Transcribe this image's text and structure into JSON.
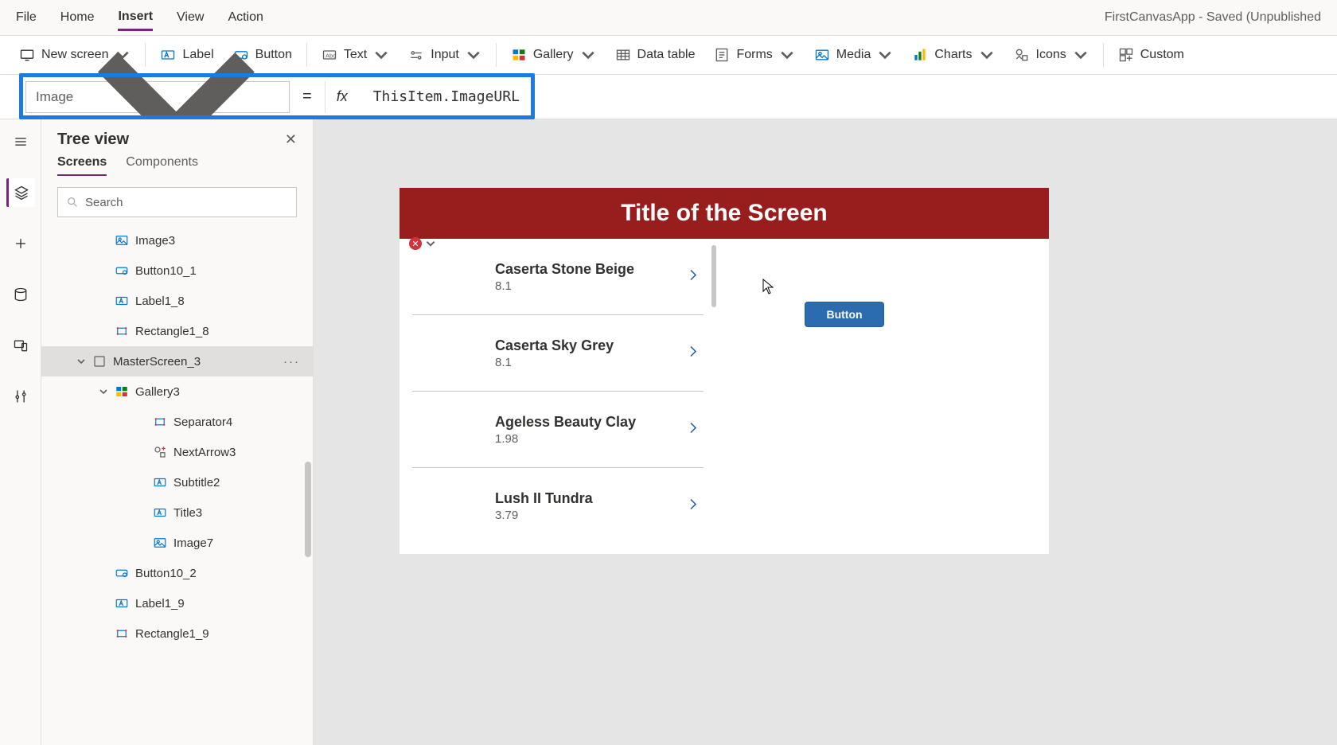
{
  "menubar": {
    "items": [
      "File",
      "Home",
      "Insert",
      "View",
      "Action"
    ],
    "active_index": 2,
    "app_title": "FirstCanvasApp - Saved (Unpublished"
  },
  "ribbon": {
    "new_screen": "New screen",
    "label": "Label",
    "button": "Button",
    "text": "Text",
    "input": "Input",
    "gallery": "Gallery",
    "data_table": "Data table",
    "forms": "Forms",
    "media": "Media",
    "charts": "Charts",
    "icons": "Icons",
    "custom": "Custom"
  },
  "formula": {
    "property": "Image",
    "equals": "=",
    "fx": "fx",
    "expression": "ThisItem.ImageURL"
  },
  "left_rail": {
    "items": [
      "menu",
      "tree",
      "add",
      "data",
      "media",
      "advanced"
    ]
  },
  "tree_panel": {
    "title": "Tree view",
    "tabs": [
      "Screens",
      "Components"
    ],
    "active_tab": 0,
    "search_placeholder": "Search",
    "items": [
      {
        "label": "Image3",
        "icon": "image",
        "indent": 2,
        "selected": false
      },
      {
        "label": "Button10_1",
        "icon": "button",
        "indent": 2,
        "selected": false
      },
      {
        "label": "Label1_8",
        "icon": "label",
        "indent": 2,
        "selected": false
      },
      {
        "label": "Rectangle1_8",
        "icon": "shape",
        "indent": 2,
        "selected": false
      },
      {
        "label": "MasterScreen_3",
        "icon": "screen",
        "indent": 1,
        "selected": true,
        "expandable": true,
        "more": true
      },
      {
        "label": "Gallery3",
        "icon": "gallery",
        "indent": 2,
        "selected": false,
        "expandable": true
      },
      {
        "label": "Separator4",
        "icon": "shape",
        "indent": 4,
        "selected": false
      },
      {
        "label": "NextArrow3",
        "icon": "icons",
        "indent": 4,
        "selected": false
      },
      {
        "label": "Subtitle2",
        "icon": "label",
        "indent": 4,
        "selected": false
      },
      {
        "label": "Title3",
        "icon": "label",
        "indent": 4,
        "selected": false
      },
      {
        "label": "Image7",
        "icon": "image",
        "indent": 4,
        "selected": false
      },
      {
        "label": "Button10_2",
        "icon": "button",
        "indent": 2,
        "selected": false
      },
      {
        "label": "Label1_9",
        "icon": "label",
        "indent": 2,
        "selected": false
      },
      {
        "label": "Rectangle1_9",
        "icon": "shape",
        "indent": 2,
        "selected": false
      }
    ]
  },
  "canvas": {
    "screen_title": "Title of the Screen",
    "button_label": "Button",
    "gallery": [
      {
        "title": "Caserta Stone Beige",
        "subtitle": "8.1"
      },
      {
        "title": "Caserta Sky Grey",
        "subtitle": "8.1"
      },
      {
        "title": "Ageless Beauty Clay",
        "subtitle": "1.98"
      },
      {
        "title": "Lush II Tundra",
        "subtitle": "3.79"
      }
    ]
  }
}
